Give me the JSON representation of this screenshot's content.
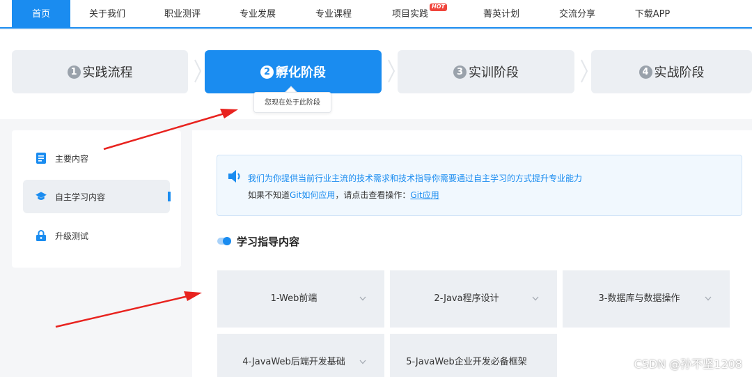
{
  "nav": {
    "items": [
      "首页",
      "关于我们",
      "职业测评",
      "专业发展",
      "专业课程",
      "项目实践",
      "菁英计划",
      "交流分享",
      "下载APP"
    ],
    "hot_badge": "HOT"
  },
  "steps": [
    {
      "num": "1",
      "label": "实践流程"
    },
    {
      "num": "2",
      "label": "孵化阶段"
    },
    {
      "num": "3",
      "label": "实训阶段"
    },
    {
      "num": "4",
      "label": "实战阶段"
    }
  ],
  "tooltip": "您现在处于此阶段",
  "sidebar": {
    "items": [
      {
        "label": "主要内容",
        "icon": "document-icon"
      },
      {
        "label": "自主学习内容",
        "icon": "graduation-cap-icon"
      },
      {
        "label": "升级测试",
        "icon": "lock-icon"
      }
    ]
  },
  "notice": {
    "line1": "我们为你提供当前行业主流的技术需求和技术指导你需要通过自主学习的方式提升专业能力",
    "line2_prefix": "如果不知道",
    "line2_link": "Git如何应用",
    "line2_middle": "，请点击查看操作：",
    "line2_link2": "Git应用"
  },
  "section_title": "学习指导内容",
  "cards": [
    "1-Web前端",
    "2-Java程序设计",
    "3-数据库与数据操作",
    "4-JavaWeb后端开发基础",
    "5-JavaWeb企业开发必备框架"
  ],
  "watermark": "CSDN @孙不坚1208",
  "colors": {
    "accent": "#1a8cf0",
    "hot": "#f0453c",
    "arrow": "#e8231f"
  }
}
